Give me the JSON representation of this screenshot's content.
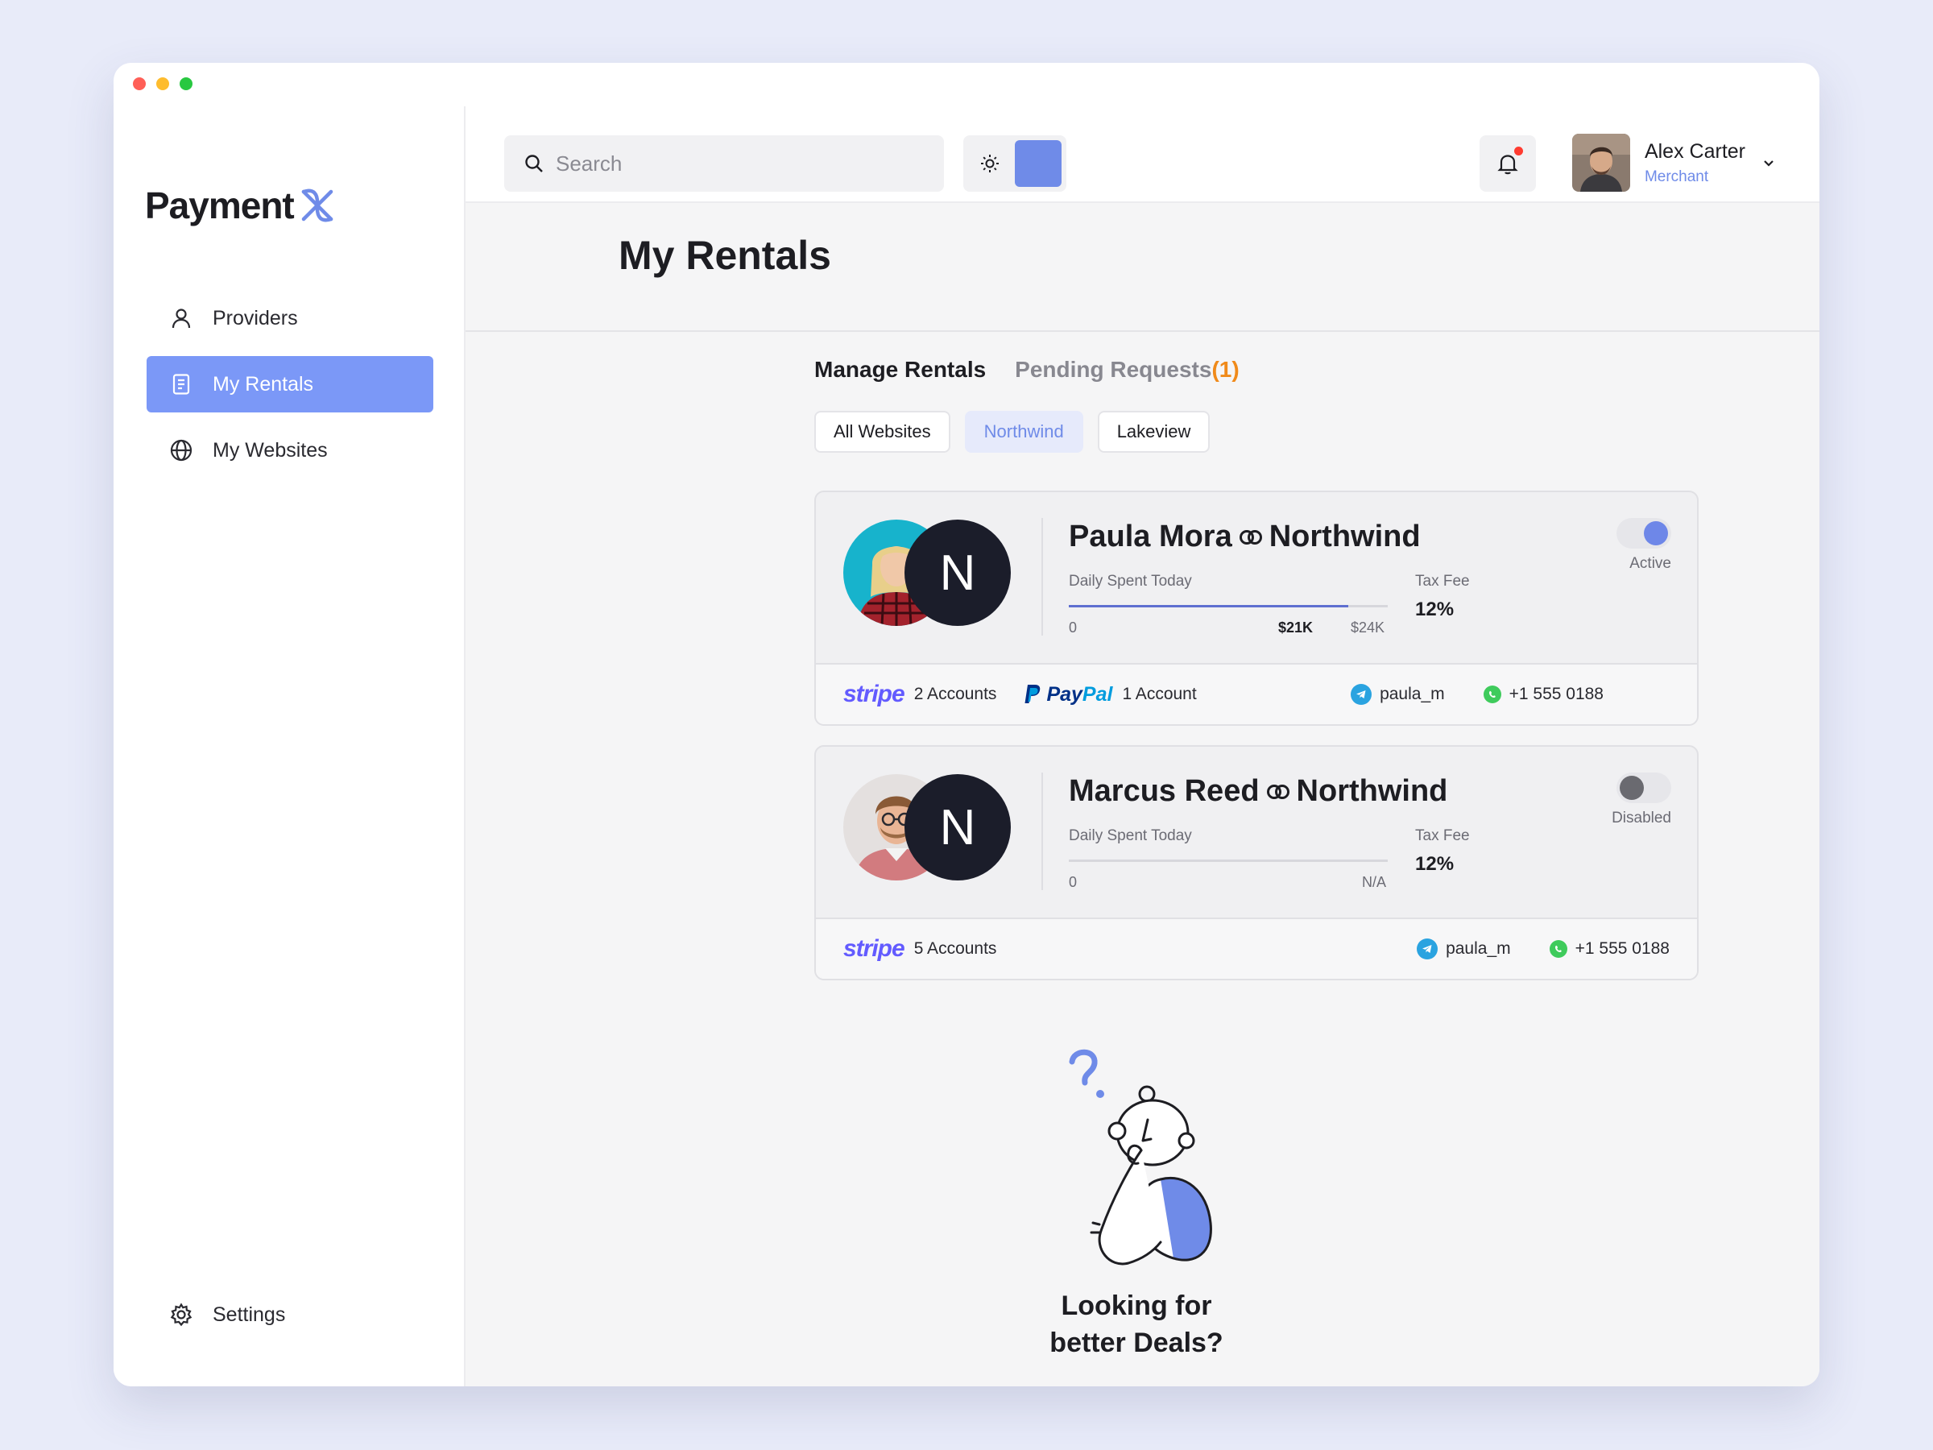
{
  "app": {
    "logo_text": "Payment"
  },
  "sidebar": {
    "items": [
      {
        "label": "Providers",
        "icon": "user-icon",
        "active": false
      },
      {
        "label": "My Rentals",
        "icon": "document-icon",
        "active": true
      },
      {
        "label": "My Websites",
        "icon": "globe-icon",
        "active": false
      }
    ],
    "settings_label": "Settings"
  },
  "topbar": {
    "search_placeholder": "Search",
    "user": {
      "name": "Alex Carter",
      "role": "Merchant"
    },
    "notification_dot": true
  },
  "page": {
    "title": "My Rentals"
  },
  "tabs": {
    "manage": "Manage Rentals",
    "pending": "Pending Requests",
    "pending_count": "(1)"
  },
  "filters": [
    "All Websites",
    "Northwind",
    "Lakeview"
  ],
  "rentals": [
    {
      "name": "Paula Mora",
      "site": "Northwind",
      "site_initial": "N",
      "daily_label": "Daily Spent Today",
      "bar_min": "0",
      "bar_current": "$21K",
      "bar_max": "$24K",
      "progress": 0.875,
      "tax_label": "Tax Fee",
      "tax_value": "12%",
      "status": "Active",
      "stripe_logo": "stripe",
      "stripe_accounts": "2 Accounts",
      "paypal_accounts": "1 Account",
      "telegram": "paula_m",
      "phone": "+1 555 0188"
    },
    {
      "name": "Marcus Reed",
      "site": "Northwind",
      "site_initial": "N",
      "daily_label": "Daily Spent Today",
      "bar_min": "0",
      "bar_max": "N/A",
      "progress": 0,
      "tax_label": "Tax Fee",
      "tax_value": "12%",
      "status": "Disabled",
      "stripe_logo": "stripe",
      "stripe_accounts": "5 Accounts",
      "telegram": "paula_m",
      "phone": "+1 555 0188"
    }
  ],
  "cta": {
    "line1": "Looking for",
    "line2": "better Deals?"
  },
  "colors": {
    "accent": "#7b98f7",
    "brand": "#6f8be8",
    "pending": "#f08a1a",
    "stripe": "#635bff"
  }
}
